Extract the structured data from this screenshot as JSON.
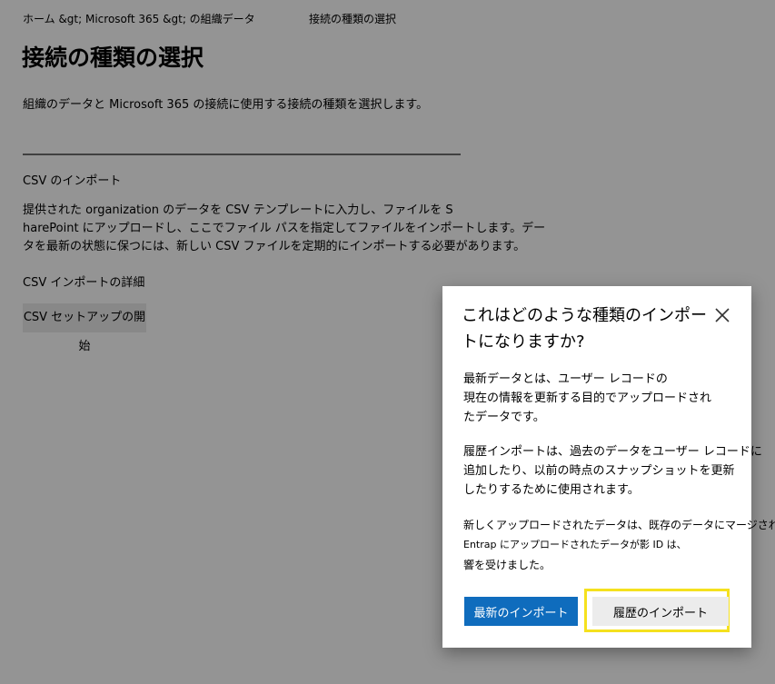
{
  "breadcrumb": {
    "path": "ホーム &gt;  Microsoft 365 &gt; の組織データ",
    "current": "接続の種類の選択"
  },
  "page": {
    "title": "接続の種類の選択",
    "description": "組織のデータと Microsoft 365 の接続に使用する接続の種類を選択します。",
    "section_title": "CSV のインポート",
    "section_body_lines": [
      "提供された organization のデータを CSV テンプレートに入力し、ファイルを S",
      "harePoint にアップロードし、ここでファイル パスを指定してファイルをインポートします。デー",
      "タを最新の状態に保つには、新しい CSV ファイルを定期的にインポートする必要があります。"
    ],
    "details_label": "CSV インポートの詳細",
    "start_button_label": "CSV セットアップの開始"
  },
  "dialog": {
    "title": "これはどのような種類のインポートになりますか?",
    "close_icon": "close-icon",
    "paragraph1_lines": [
      "最新データとは、ユーザー レコードの",
      " 現在の情報を更新する目的でアップロードされ",
      "たデータです。"
    ],
    "paragraph2_lines": [
      "履歴インポートは、過去のデータをユーザー レコードに",
      "追加したり、以前の時点のスナップショットを更新",
      "したりするために使用されます。"
    ],
    "paragraph3_lines": [
      "新しくアップロードされたデータは、既存のデータにマージされます。",
      "Entrap にアップロードされたデータが影     ID は、",
      "響を受けました。"
    ],
    "primary_button_label": "最新のインポート",
    "secondary_button_label": "履歴のインポート"
  },
  "colors": {
    "primary": "#0f6cbd",
    "highlight": "#f5e11e",
    "overlay": "rgba(0,0,0,0.42)"
  }
}
